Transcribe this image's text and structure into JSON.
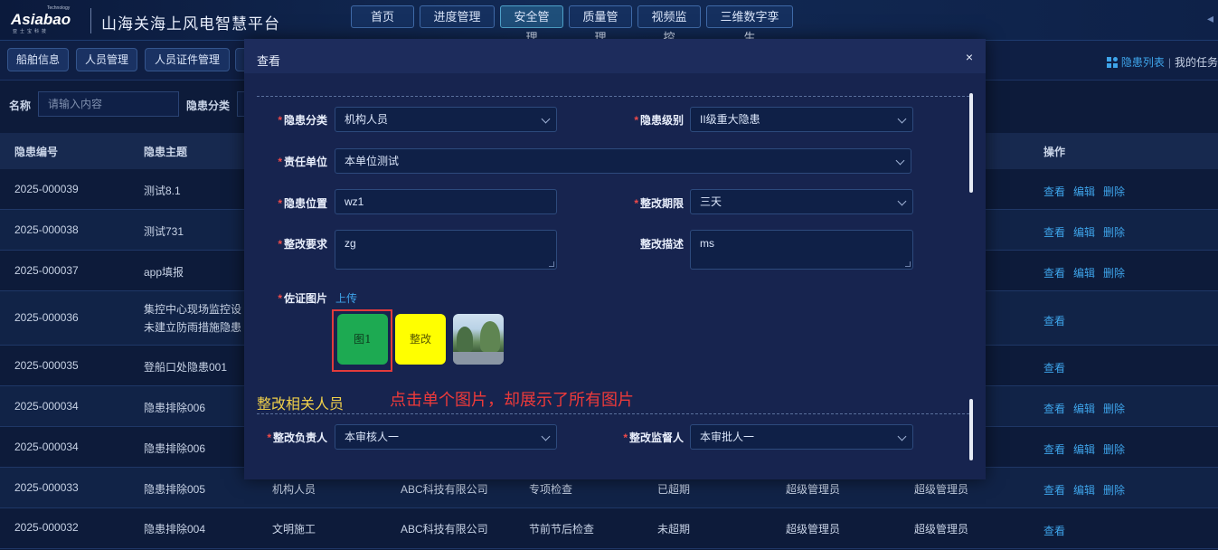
{
  "header": {
    "logo_brand": "Asiabao",
    "logo_tagline": "Technology",
    "logo_sub": "亚士宝科技",
    "platform_title": "山海关海上风电智慧平台",
    "nav": [
      {
        "label": "首页"
      },
      {
        "label": "进度管理"
      },
      {
        "label": "安全管理",
        "active": true
      },
      {
        "label": "质量管理"
      },
      {
        "label": "视频监控"
      },
      {
        "label": "三维数字孪生"
      }
    ]
  },
  "subbar": {
    "tabs": [
      "船舶信息",
      "人员管理",
      "人员证件管理"
    ],
    "right_link_active": "隐患列表",
    "right_link_other": "我的任务"
  },
  "filters": {
    "name_label": "名称",
    "name_placeholder": "请输入内容",
    "category_label": "隐患分类"
  },
  "table": {
    "headers": [
      "隐患编号",
      "隐患主题",
      "操作"
    ],
    "rows": [
      {
        "id": "2025-000039",
        "topic": "测试8.1",
        "ops": [
          "查看",
          "编辑",
          "删除"
        ]
      },
      {
        "id": "2025-000038",
        "topic": "测试731",
        "ops": [
          "查看",
          "编辑",
          "删除"
        ]
      },
      {
        "id": "2025-000037",
        "topic": "app填报",
        "ops": [
          "查看",
          "编辑",
          "删除"
        ]
      },
      {
        "id": "2025-000036",
        "topic": "集控中心现场监控设",
        "topic2": "未建立防雨措施隐患",
        "ops": [
          "查看"
        ]
      },
      {
        "id": "2025-000035",
        "topic": "登船口处隐患001",
        "ops": [
          "查看"
        ]
      },
      {
        "id": "2025-000034",
        "topic": "隐患排除006",
        "ops": [
          "查看",
          "编辑",
          "删除"
        ]
      },
      {
        "id": "2025-000034",
        "topic": "隐患排除006",
        "ops": [
          "查看",
          "编辑",
          "删除"
        ]
      },
      {
        "id": "2025-000033",
        "topic": "隐患排除005",
        "category": "机构人员",
        "company": "ABC科技有限公司",
        "type": "专项检查",
        "status": "已超期",
        "p1": "超级管理员",
        "p2": "超级管理员",
        "ops": [
          "查看",
          "编辑",
          "删除"
        ]
      },
      {
        "id": "2025-000032",
        "topic": "隐患排除004",
        "category": "文明施工",
        "company": "ABC科技有限公司",
        "type": "节前节后检查",
        "status": "未超期",
        "p1": "超级管理员",
        "p2": "超级管理员",
        "ops": [
          "查看"
        ]
      }
    ]
  },
  "modal": {
    "title": "查看",
    "close": "×",
    "fields": {
      "category_label": "隐患分类",
      "category_value": "机构人员",
      "level_label": "隐患级别",
      "level_value": "II级重大隐患",
      "unit_label": "责任单位",
      "unit_value": "本单位测试",
      "location_label": "隐患位置",
      "location_value": "wz1",
      "deadline_label": "整改期限",
      "deadline_value": "三天",
      "requirement_label": "整改要求",
      "requirement_value": "zg",
      "description_label": "整改描述",
      "description_value": "ms",
      "evidence_label": "佐证图片",
      "upload_label": "上传"
    },
    "thumbnails": [
      "图1",
      "整改"
    ],
    "section_title": "整改相关人员",
    "annotation": "点击单个图片，却展示了所有图片",
    "people": {
      "owner_label": "整改负责人",
      "owner_value": "本审核人一",
      "supervisor_label": "整改监督人",
      "supervisor_value": "本审批人一"
    }
  }
}
